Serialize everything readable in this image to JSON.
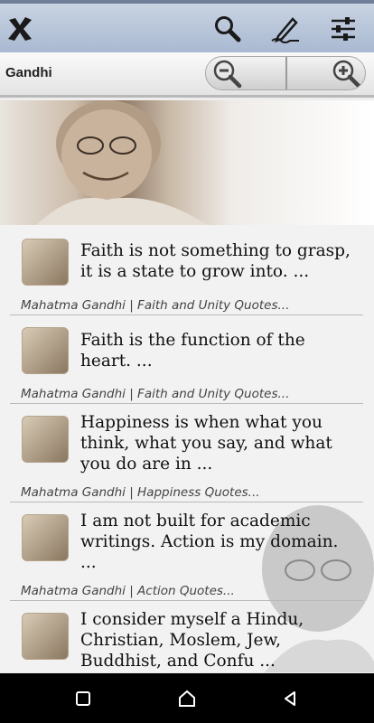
{
  "header": {
    "title": "Gandhi"
  },
  "toolbar": {
    "icons": [
      "close-icon",
      "search-icon",
      "edit-icon",
      "settings-icon"
    ],
    "zoom": [
      "zoom-out-icon",
      "zoom-in-icon"
    ]
  },
  "quotes": [
    {
      "text": "Faith is not something to grasp, it is a state to grow into. ...",
      "source": "Mahatma Gandhi | Faith and Unity Quotes..."
    },
    {
      "text": "Faith is the function of the heart. ...",
      "source": "Mahatma Gandhi | Faith and Unity Quotes..."
    },
    {
      "text": "Happiness is when what you think, what you say, and what you do are in ...",
      "source": "Mahatma Gandhi | Happiness Quotes..."
    },
    {
      "text": "I am not built for academic writings. Action is my domain. ...",
      "source": "Mahatma Gandhi | Action Quotes..."
    },
    {
      "text": "I consider myself a Hindu, Christian, Moslem, Jew, Buddhist, and Confu ...",
      "source": ""
    }
  ],
  "colors": {
    "topbar": "#b7c4d8",
    "navbar": "#000000",
    "text": "#111111"
  },
  "nav": [
    "recents-icon",
    "home-icon",
    "back-icon"
  ]
}
